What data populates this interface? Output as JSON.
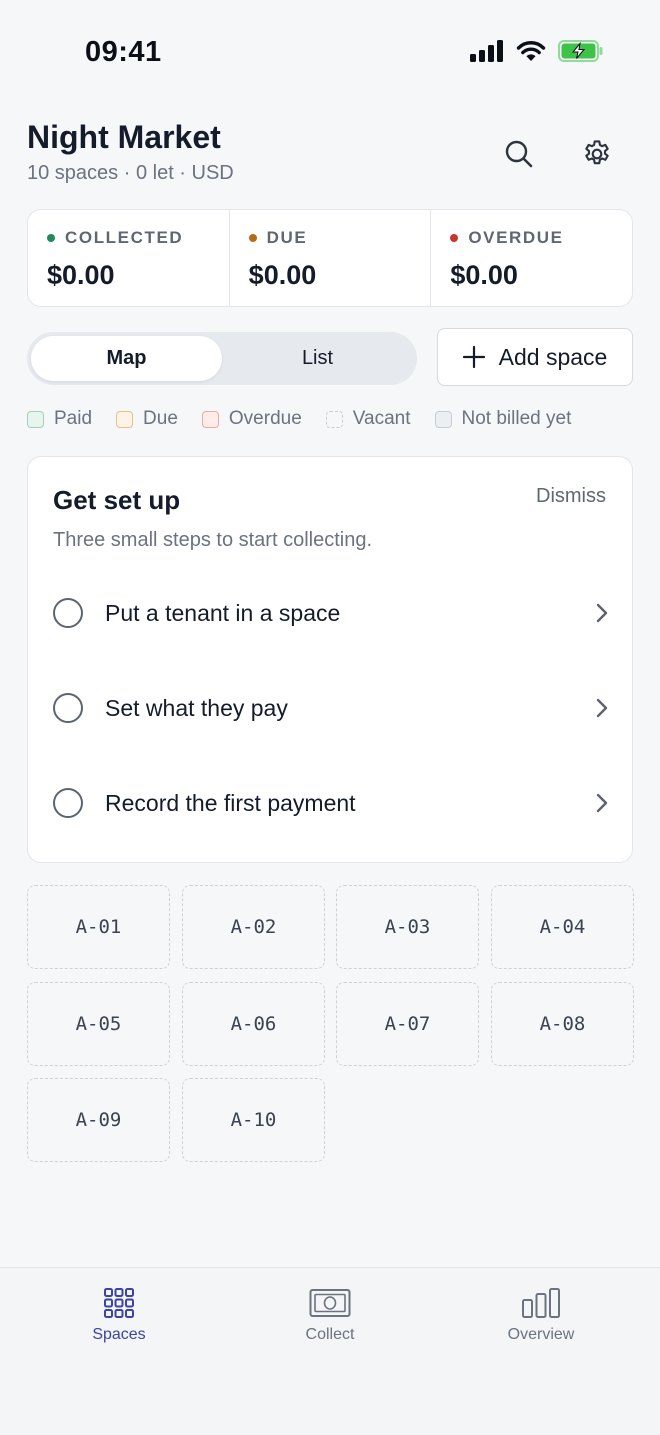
{
  "status_bar": {
    "time": "09:41"
  },
  "header": {
    "title": "Night Market",
    "subtitle": "10 spaces · 0 let · USD"
  },
  "summary": [
    {
      "label": "COLLECTED",
      "value": "$0.00",
      "color": "#1f8a5b"
    },
    {
      "label": "DUE",
      "value": "$0.00",
      "color": "#b86a1b"
    },
    {
      "label": "OVERDUE",
      "value": "$0.00",
      "color": "#c8372d"
    }
  ],
  "view_toggle": {
    "map_label": "Map",
    "list_label": "List",
    "selected": "Map"
  },
  "add_space_label": "Add space",
  "legend": [
    {
      "label": "Paid",
      "fill": "#e8f5ee",
      "border": "#9fd3b6",
      "style": "solid"
    },
    {
      "label": "Due",
      "fill": "#fdf3e6",
      "border": "#ebbd86",
      "style": "solid"
    },
    {
      "label": "Overdue",
      "fill": "#fdecea",
      "border": "#eea9a3",
      "style": "solid"
    },
    {
      "label": "Vacant",
      "fill": "#f5f7f9",
      "border": "#c8cdd3",
      "style": "dashed"
    },
    {
      "label": "Not billed yet",
      "fill": "#eceff2",
      "border": "#c8cdd3",
      "style": "solid"
    }
  ],
  "setup": {
    "title": "Get set up",
    "subtitle": "Three small steps to start collecting.",
    "dismiss_label": "Dismiss",
    "steps": [
      {
        "label": "Put a tenant in a space"
      },
      {
        "label": "Set what they pay"
      },
      {
        "label": "Record the first payment"
      }
    ]
  },
  "spaces": [
    "A-01",
    "A-02",
    "A-03",
    "A-04",
    "A-05",
    "A-06",
    "A-07",
    "A-08",
    "A-09",
    "A-10"
  ],
  "tabs": [
    {
      "label": "Spaces",
      "icon": "grid-icon",
      "active": true
    },
    {
      "label": "Collect",
      "icon": "cash-icon",
      "active": false
    },
    {
      "label": "Overview",
      "icon": "bar-chart-icon",
      "active": false
    }
  ],
  "colors": {
    "accent": "#3a43a6",
    "battery": "#3ec24a"
  }
}
